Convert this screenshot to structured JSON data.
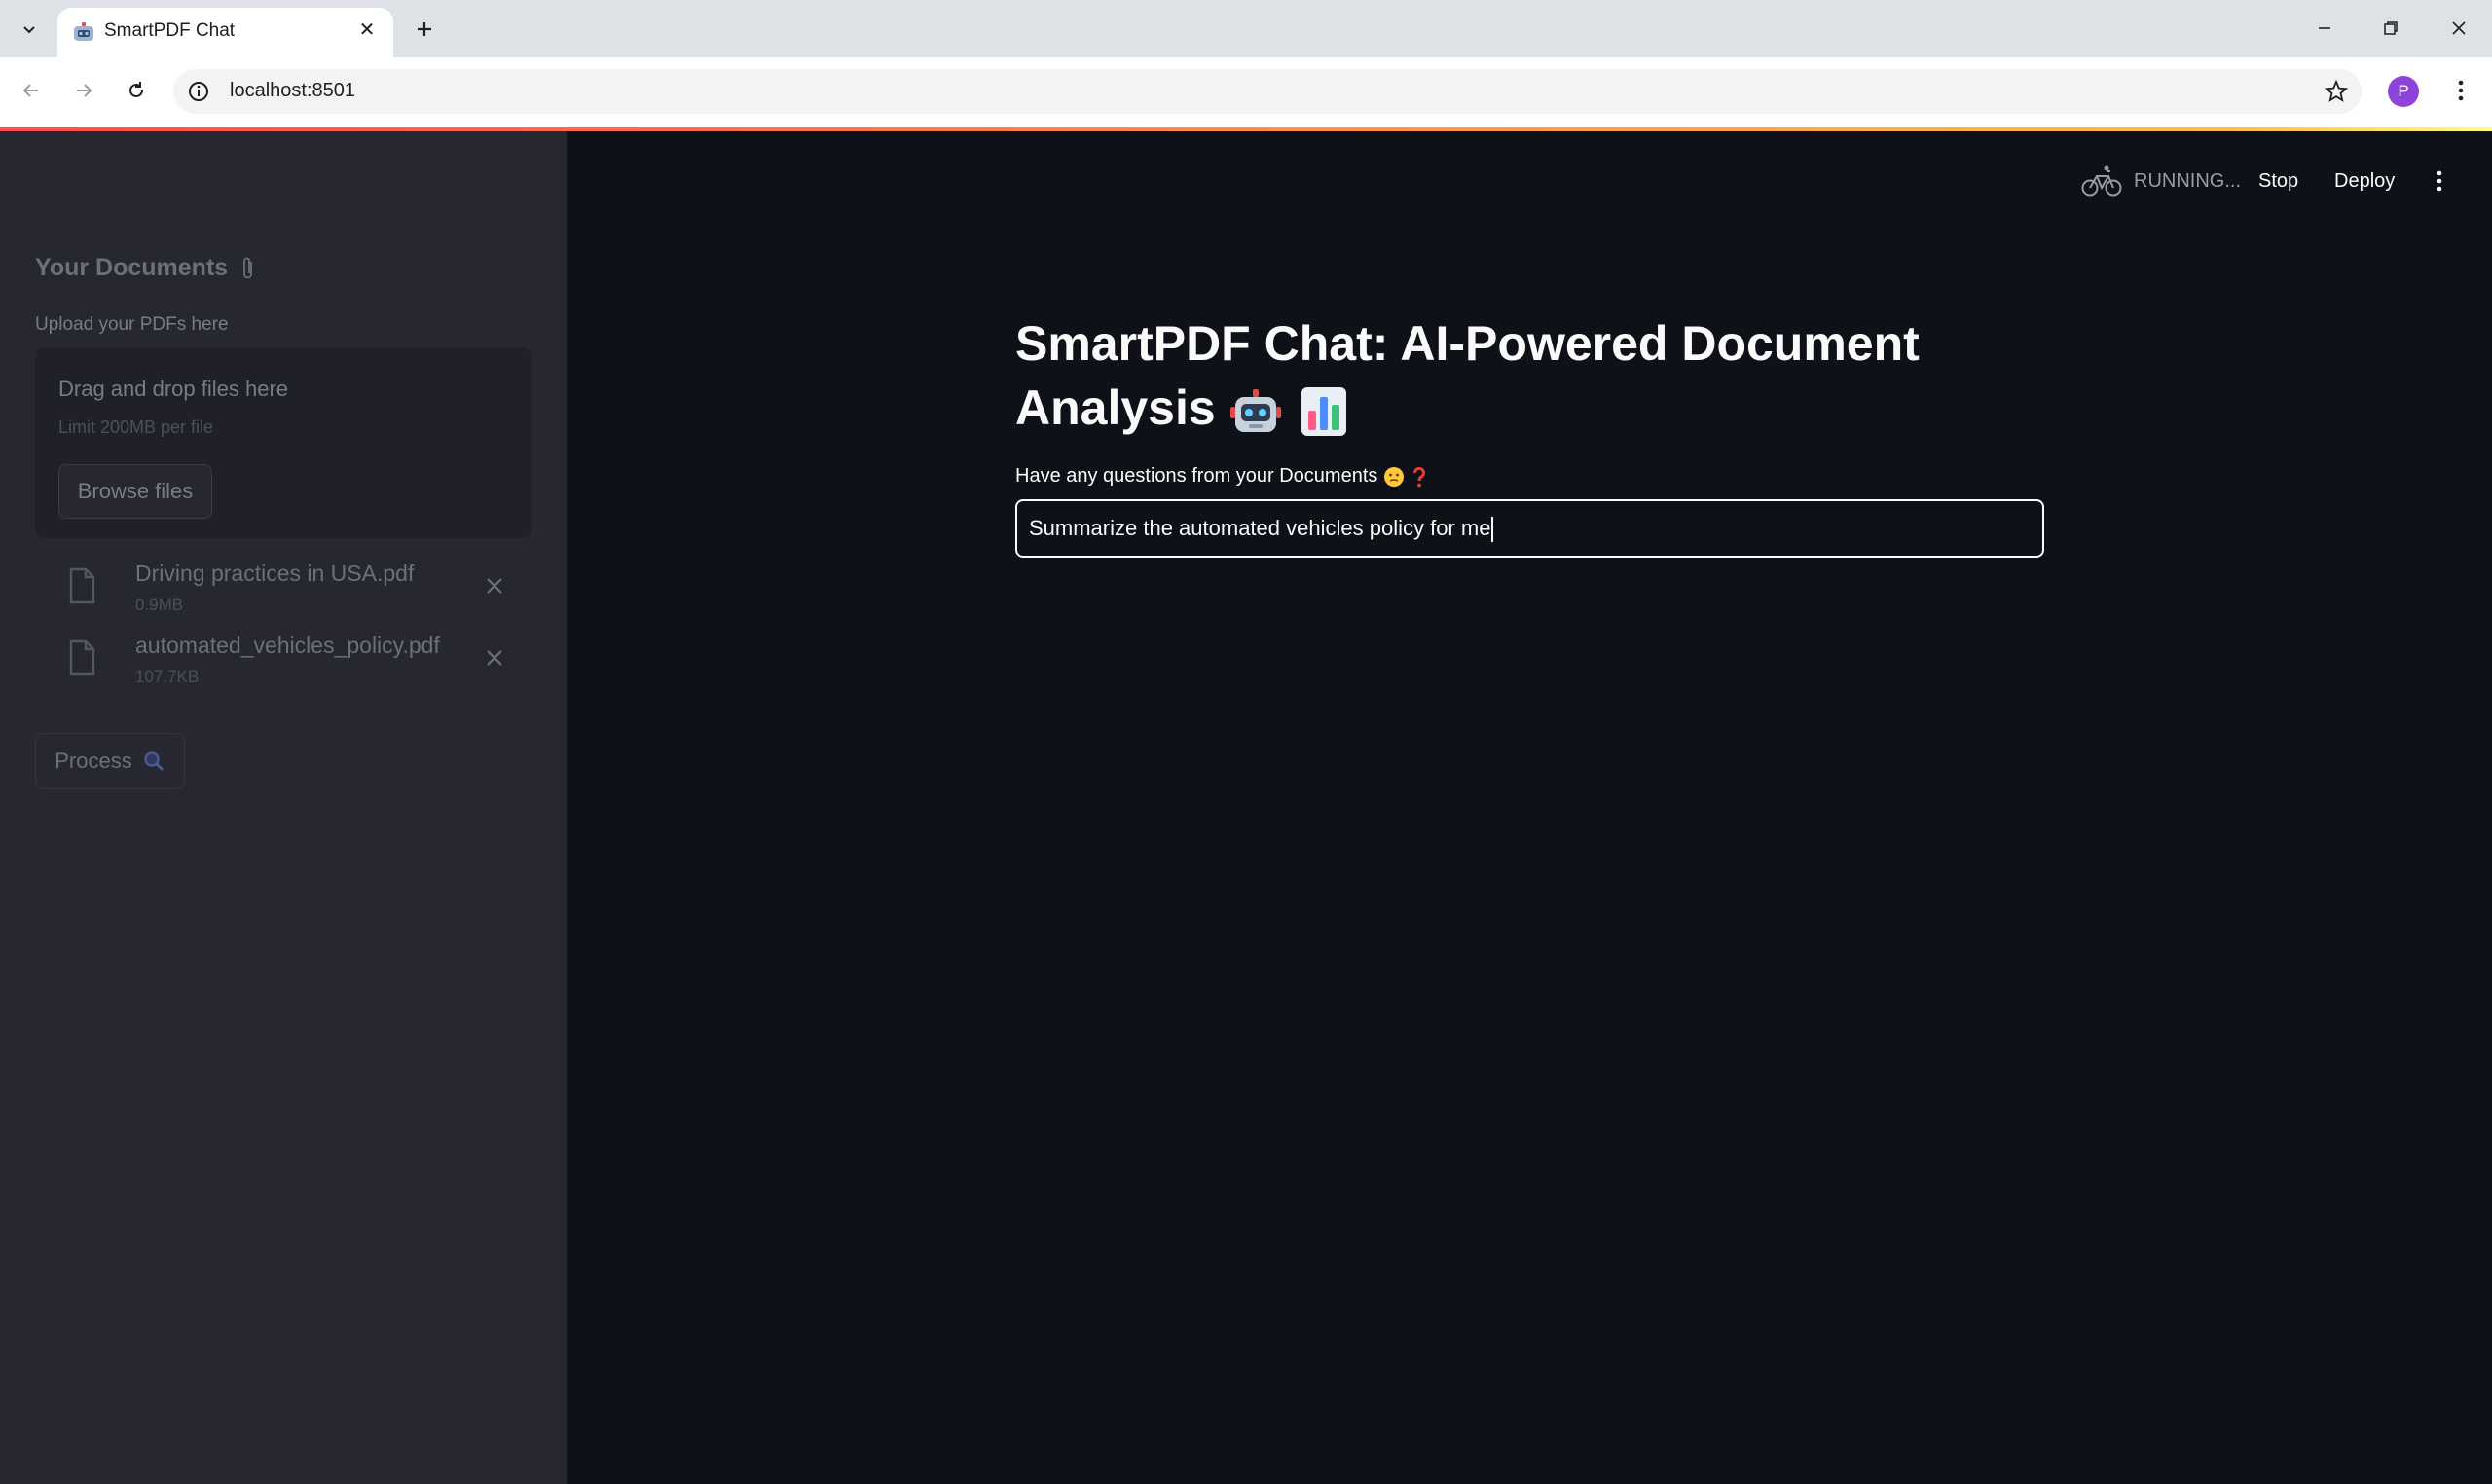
{
  "browser": {
    "tab_title": "SmartPDF Chat",
    "url": "localhost:8501",
    "profile_initial": "P"
  },
  "sidebar": {
    "heading": "Your Documents",
    "upload_label": "Upload your PDFs here",
    "dropzone_title": "Drag and drop files here",
    "dropzone_limit": "Limit 200MB per file",
    "browse_label": "Browse files",
    "files": [
      {
        "name": "Driving practices in USA.pdf",
        "size": "0.9MB"
      },
      {
        "name": "automated_vehicles_policy.pdf",
        "size": "107.7KB"
      }
    ],
    "process_label": "Process"
  },
  "header": {
    "status": "RUNNING...",
    "stop_label": "Stop",
    "deploy_label": "Deploy"
  },
  "main": {
    "title": "SmartPDF Chat: AI-Powered Document Analysis",
    "question_label": "Have any questions from your Documents",
    "question_value": "Summarize the automated vehicles policy for me"
  },
  "colors": {
    "background": "#0e1117",
    "sidebar": "#262730",
    "accent": "#ff4b4b",
    "text": "#fafafa"
  }
}
